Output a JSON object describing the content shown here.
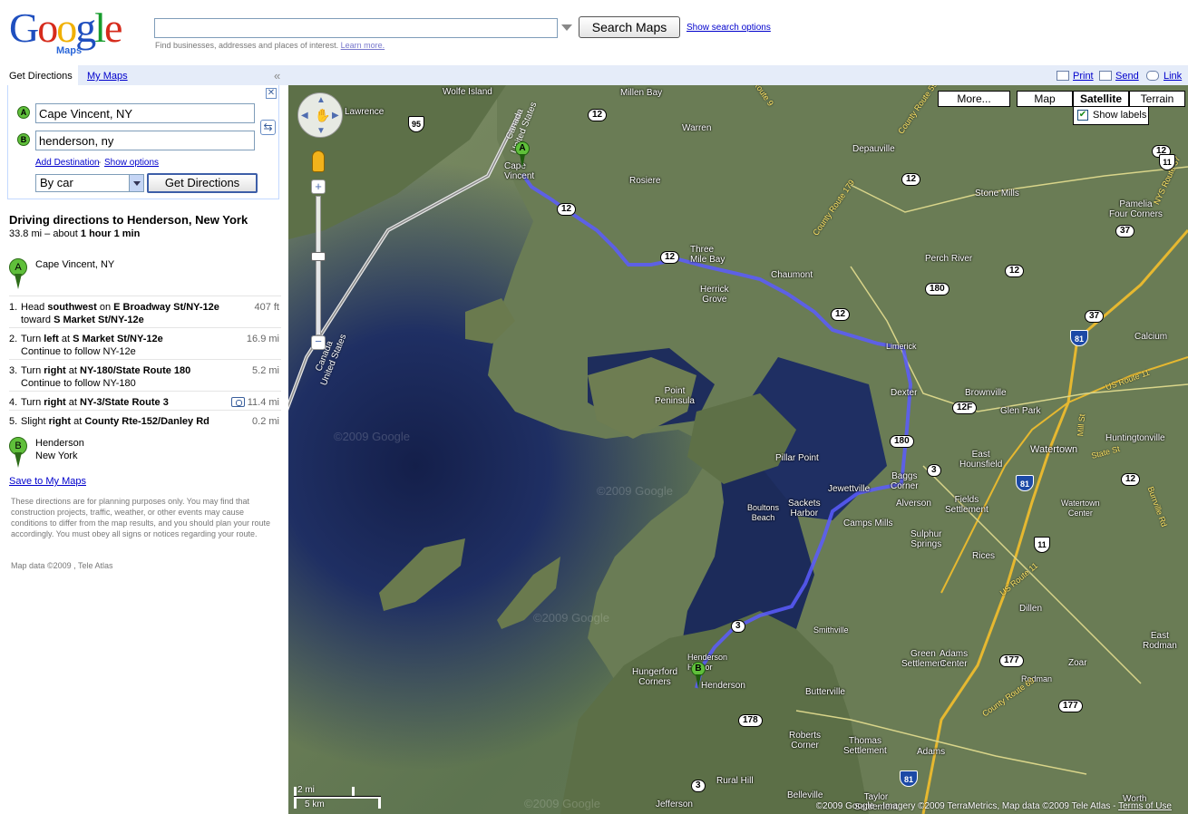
{
  "header": {
    "logo_text": "Google",
    "logo_sub": "Maps",
    "search_value": "",
    "search_button": "Search Maps",
    "show_search_options": "Show search options",
    "hint_text": "Find businesses, addresses and places of interest.",
    "learn_more": "Learn more."
  },
  "panel": {
    "tab_directions": "Get Directions",
    "tab_mymaps": "My Maps",
    "collapse_icon": "«",
    "from_marker": "A",
    "to_marker": "B",
    "from_value": "Cape Vincent, NY",
    "to_value": "henderson, ny",
    "add_destination": "Add Destination",
    "separator": "-",
    "show_options": "Show options",
    "travel_mode": "By car",
    "get_directions": "Get Directions",
    "route_title": "Driving directions to Henderson, New York",
    "route_distance": "33.8 mi",
    "route_about": "– about",
    "route_time": "1 hour 1 min",
    "start_label": "Cape Vincent, NY",
    "steps": [
      {
        "num": "1.",
        "pre": "Head ",
        "b1": "southwest",
        "mid": " on ",
        "b2": "E Broadway St/NY-12e",
        "sub_pre": "toward ",
        "sub_b": "S Market St/NY-12e",
        "dist": "407 ft"
      },
      {
        "num": "2.",
        "pre": "Turn ",
        "b1": "left",
        "mid": " at ",
        "b2": "S Market St/NY-12e",
        "sub_pre": "Continue to follow NY-12e",
        "sub_b": "",
        "dist": "16.9 mi"
      },
      {
        "num": "3.",
        "pre": "Turn ",
        "b1": "right",
        "mid": " at ",
        "b2": "NY-180/State Route 180",
        "sub_pre": "Continue to follow NY-180",
        "sub_b": "",
        "dist": "5.2 mi"
      },
      {
        "num": "4.",
        "pre": "Turn ",
        "b1": "right",
        "mid": " at ",
        "b2": "NY-3/State Route 3",
        "sub_pre": "",
        "sub_b": "",
        "dist": "11.4 mi"
      },
      {
        "num": "5.",
        "pre": "Slight ",
        "b1": "right",
        "mid": " at ",
        "b2": "County Rte-152/Danley Rd",
        "sub_pre": "",
        "sub_b": "",
        "dist": "0.2 mi"
      }
    ],
    "end_label_1": "Henderson",
    "end_label_2": "New York",
    "save_link": "Save to My Maps",
    "disclaimer": "These directions are for planning purposes only. You may find that construction projects, traffic, weather, or other events may cause conditions to differ from the map results, and you should plan your route accordingly. You must obey all signs or notices regarding your route.",
    "map_data_note": "Map data ©2009 , Tele Atlas"
  },
  "toolbar": {
    "print": "Print",
    "send": "Send",
    "link": "Link"
  },
  "map": {
    "more": "More...",
    "type_map": "Map",
    "type_satellite": "Satellite",
    "type_terrain": "Terrain",
    "show_labels": "Show labels",
    "scale_mi": "2 mi",
    "scale_km": "5 km",
    "copyright": "©2009 Google - Imagery ©2009 TerraMetrics, Map data ©2009 Tele Atlas -",
    "terms": "Terms of Use",
    "watermark": "©2009 Google",
    "border_label": "Canada\nUnited States",
    "places": [
      "Wolfe Island",
      "Millen Bay",
      "Lawrence",
      "Warren",
      "Depauville",
      "Cape Vincent",
      "Rosiere",
      "Three Mile Bay",
      "Chaumont",
      "Herrick Grove",
      "Stone Mills",
      "Pamelia Four Corners",
      "Perch River",
      "Limerick",
      "Point Peninsula",
      "Dexter",
      "Brownville",
      "Glen Park",
      "Watertown",
      "Huntingtonville",
      "Calcium",
      "Pillar Point",
      "East Hounsfield",
      "Baggs Corner",
      "Jewettville",
      "Alverson",
      "Fields Settlement",
      "Watertown Center",
      "Boultons Beach",
      "Sackets Harbor",
      "Camps Mills",
      "Sulphur Springs",
      "Rices",
      "Dillen",
      "Smithville",
      "Henderson Harbor",
      "Henderson",
      "Hungerford Corners",
      "Green Settlement",
      "Adams Center",
      "Rodman",
      "Zoar",
      "East Rodman",
      "Butterville",
      "Roberts Corner",
      "Thomas Settlement",
      "Adams",
      "Rural Hill",
      "Belleville",
      "Taylor Settlement",
      "Jefferson",
      "Worth"
    ],
    "route_shields": [
      "12",
      "12",
      "12",
      "12",
      "180",
      "3",
      "12F",
      "3",
      "177",
      "177",
      "178",
      "37",
      "37",
      "12",
      "180",
      "12",
      "12",
      "3",
      "12"
    ],
    "us_shields": [
      "11",
      "11"
    ],
    "interstate_shields": [
      "81",
      "81",
      "81"
    ],
    "route_95": "95",
    "road_labels": [
      "County Route 179",
      "County Route 59",
      "US Route 11",
      "US Route 11",
      "NYS Route 37",
      "State St",
      "Mill St",
      "Burrville Rd",
      "County Route 69",
      "Route 9"
    ],
    "colors": {
      "route_line": "#5a5cff",
      "pin_green": "#5fbf3a",
      "water_dark": "#1f2f63"
    }
  }
}
